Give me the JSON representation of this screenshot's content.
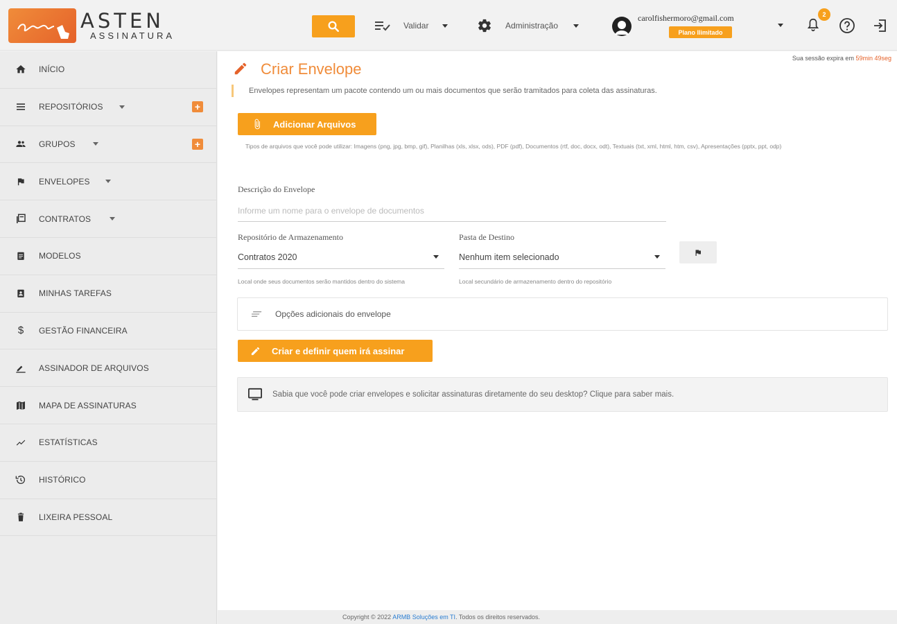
{
  "header": {
    "brand_name": "ASTEN",
    "brand_sub": "ASSINATURA",
    "menu_validar": "Validar",
    "menu_admin": "Administração",
    "user_email": "carolfishermoro@gmail.com",
    "plan_badge": "Plano Ilimitado",
    "notification_count": "2"
  },
  "sidebar": {
    "items": [
      {
        "label": "INÍCIO",
        "icon": "home-icon"
      },
      {
        "label": "REPOSITÓRIOS",
        "icon": "list-icon"
      },
      {
        "label": "GRUPOS",
        "icon": "people-icon"
      },
      {
        "label": "ENVELOPES",
        "icon": "flag-icon"
      },
      {
        "label": "CONTRATOS",
        "icon": "library-icon"
      },
      {
        "label": "MODELOS",
        "icon": "clipboard-icon"
      },
      {
        "label": "MINHAS TAREFAS",
        "icon": "task-icon"
      },
      {
        "label": "GESTÃO FINANCEIRA",
        "icon": "dollar-icon"
      },
      {
        "label": "ASSINADOR DE ARQUIVOS",
        "icon": "sign-icon"
      },
      {
        "label": "MAPA DE ASSINATURAS",
        "icon": "map-icon"
      },
      {
        "label": "ESTATÍSTICAS",
        "icon": "chart-icon"
      },
      {
        "label": "HISTÓRICO",
        "icon": "history-icon"
      },
      {
        "label": "LIXEIRA PESSOAL",
        "icon": "trash-icon"
      }
    ]
  },
  "main": {
    "session_prefix": "Sua sessão expira em",
    "session_time": "59min 49seg",
    "title": "Criar Envelope",
    "description": "Envelopes representam um pacote contendo um ou mais documentos que serão tramitados para coleta das assinaturas.",
    "add_files_button": "Adicionar Arquivos",
    "file_types": "Tipos de arquivos que você pode utilizar: Imagens (png, jpg, bmp, gif), Planilhas (xls, xlsx, ods), PDF (pdf), Documentos (rtf, doc, docx, odt), Textuais (txt, xml, html, htm, csv), Apresentações (pptx, ppt, odp)",
    "envelope_desc_label": "Descrição do Envelope",
    "envelope_desc_placeholder": "Informe um nome para o envelope de documentos",
    "repo_label": "Repositório de Armazenamento",
    "repo_value": "Contratos 2020",
    "repo_hint": "Local onde seus documentos serão mantidos dentro do sistema",
    "folder_label": "Pasta de Destino",
    "folder_value": "Nenhum item selecionado",
    "folder_hint": "Local secundário de armazenamento dentro do repositório",
    "options_label": "Opções adicionais do envelope",
    "create_button": "Criar e definir quem irá assinar",
    "desktop_info": "Sabia que você pode criar envelopes e solicitar assinaturas diretamente do seu desktop? Clique para saber mais."
  },
  "footer": {
    "prefix": "Copyright © 2022",
    "company": "ARMB Soluções em TI",
    "suffix": ". Todos os direitos reservados."
  },
  "colors": {
    "accent": "#f7a01d",
    "title": "#f08c3a",
    "logo_gradient_start": "#f08c3a",
    "logo_gradient_end": "#e5622a"
  }
}
